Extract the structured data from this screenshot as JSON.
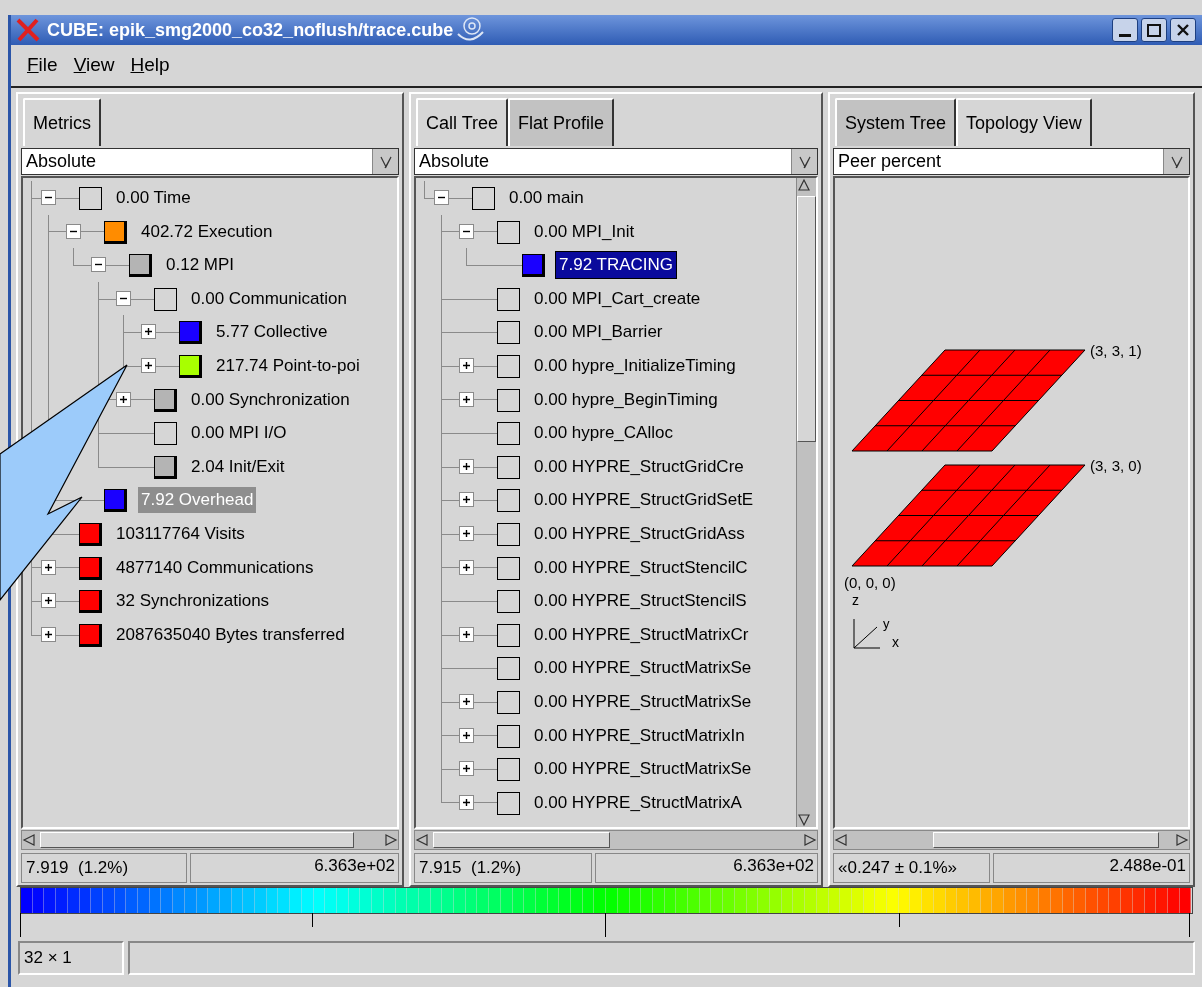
{
  "window": {
    "title": "CUBE: epik_smg2000_co32_noflush/trace.cube"
  },
  "menu": [
    {
      "label": "File"
    },
    {
      "label": "View"
    },
    {
      "label": "Help"
    }
  ],
  "panels": [
    {
      "kind": "tree",
      "tabs": [
        {
          "label": "Metrics",
          "selected": true
        }
      ],
      "dropdown": "Absolute",
      "focused": false,
      "tree": [
        {
          "label": "0.00 Time",
          "has_children": true,
          "expanded": true,
          "selected": false,
          "children": [
            {
              "label": "402.72 Execution",
              "has_children": true,
              "expanded": true,
              "color": "#ff8c00",
              "selected": false,
              "children": [
                {
                  "label": "0.12 MPI",
                  "has_children": true,
                  "expanded": true,
                  "color": "#b4b4b4",
                  "selected": false,
                  "children": [
                    {
                      "label": "0.00 Communication",
                      "has_children": true,
                      "expanded": true,
                      "selected": false,
                      "children": [
                        {
                          "label": "5.77 Collective",
                          "has_children": true,
                          "expanded": false,
                          "color": "#1a00ff",
                          "selected": false
                        },
                        {
                          "label": "217.74 Point-to-poi",
                          "has_children": true,
                          "expanded": false,
                          "color": "#a8ff00",
                          "selected": false
                        }
                      ]
                    },
                    {
                      "label": "0.00 Synchronization",
                      "has_children": true,
                      "expanded": false,
                      "color": "#b4b4b4",
                      "selected": false
                    },
                    {
                      "label": "0.00 MPI I/O",
                      "has_children": false,
                      "selected": false
                    },
                    {
                      "label": "2.04 Init/Exit",
                      "has_children": false,
                      "color": "#b4b4b4",
                      "selected": false
                    }
                  ]
                }
              ]
            },
            {
              "label": "7.92 Overhead",
              "has_children": false,
              "color": "#1a00ff",
              "selected": true
            }
          ]
        },
        {
          "label": "103117764 Visits",
          "has_children": false,
          "color": "#ff0000",
          "selected": false
        },
        {
          "label": "4877140 Communications",
          "has_children": true,
          "expanded": false,
          "color": "#ff0000",
          "selected": false
        },
        {
          "label": "32 Synchronizations",
          "has_children": true,
          "expanded": false,
          "color": "#ff0000",
          "selected": false
        },
        {
          "label": "2087635040 Bytes transferred",
          "has_children": true,
          "expanded": false,
          "color": "#ff0000",
          "selected": false
        }
      ],
      "status": [
        "7.919  (1.2%)",
        "6.363e+02"
      ]
    },
    {
      "kind": "tree",
      "tabs": [
        {
          "label": "Call Tree",
          "selected": true
        },
        {
          "label": "Flat Profile",
          "selected": false
        }
      ],
      "dropdown": "Absolute",
      "focused": true,
      "tree": [
        {
          "label": "0.00 main",
          "has_children": true,
          "expanded": true,
          "selected": false,
          "children": [
            {
              "label": "0.00 MPI_Init",
              "has_children": true,
              "expanded": true,
              "selected": false,
              "children": [
                {
                  "label": "7.92 TRACING",
                  "has_children": false,
                  "color": "#1a00ff",
                  "selected": true
                }
              ]
            },
            {
              "label": "0.00 MPI_Cart_create",
              "has_children": false,
              "selected": false
            },
            {
              "label": "0.00 MPI_Barrier",
              "has_children": false,
              "selected": false
            },
            {
              "label": "0.00 hypre_InitializeTiming",
              "has_children": true,
              "expanded": false,
              "selected": false
            },
            {
              "label": "0.00 hypre_BeginTiming",
              "has_children": true,
              "expanded": false,
              "selected": false
            },
            {
              "label": "0.00 hypre_CAlloc",
              "has_children": false,
              "selected": false
            },
            {
              "label": "0.00 HYPRE_StructGridCre",
              "has_children": true,
              "expanded": false,
              "selected": false
            },
            {
              "label": "0.00 HYPRE_StructGridSetE",
              "has_children": true,
              "expanded": false,
              "selected": false
            },
            {
              "label": "0.00 HYPRE_StructGridAss",
              "has_children": true,
              "expanded": false,
              "selected": false
            },
            {
              "label": "0.00 HYPRE_StructStencilC",
              "has_children": true,
              "expanded": false,
              "selected": false
            },
            {
              "label": "0.00 HYPRE_StructStencilS",
              "has_children": false,
              "selected": false
            },
            {
              "label": "0.00 HYPRE_StructMatrixCr",
              "has_children": true,
              "expanded": false,
              "selected": false
            },
            {
              "label": "0.00 HYPRE_StructMatrixSe",
              "has_children": false,
              "selected": false
            },
            {
              "label": "0.00 HYPRE_StructMatrixSe",
              "has_children": true,
              "expanded": false,
              "selected": false
            },
            {
              "label": "0.00 HYPRE_StructMatrixIn",
              "has_children": true,
              "expanded": false,
              "selected": false
            },
            {
              "label": "0.00 HYPRE_StructMatrixSe",
              "has_children": true,
              "expanded": false,
              "selected": false
            },
            {
              "label": "0.00 HYPRE_StructMatrixA",
              "has_children": true,
              "expanded": false,
              "selected": false
            }
          ]
        }
      ],
      "status": [
        "7.915  (1.2%)",
        "6.363e+02"
      ]
    },
    {
      "kind": "topology",
      "tabs": [
        {
          "label": "System Tree",
          "selected": false
        },
        {
          "label": "Topology View",
          "selected": true
        }
      ],
      "dropdown": "Peer percent",
      "planes": [
        {
          "label": "(3, 3, 1)"
        },
        {
          "label": "(3, 3, 0)"
        }
      ],
      "origin_label": "(0, 0, 0)",
      "axes": [
        "z",
        "y",
        "x"
      ],
      "status": [
        "«0.247 ± 0.1%»",
        "2.488e-01"
      ]
    }
  ],
  "status_bar": {
    "dims": "32 × 1"
  }
}
